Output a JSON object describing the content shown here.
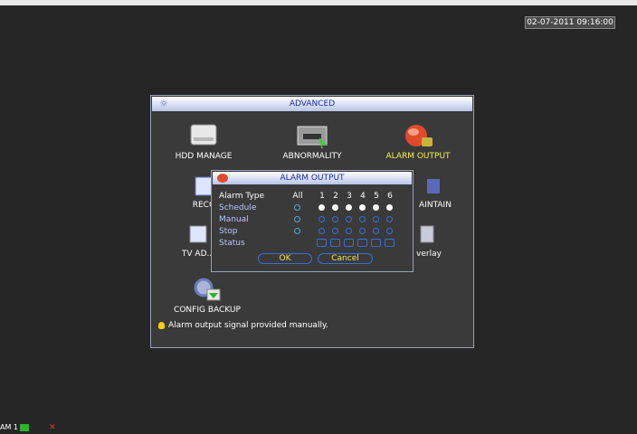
{
  "datetime": "02-07-2011 09:16:00",
  "advanced": {
    "title": "ADVANCED",
    "items": [
      {
        "label": "HDD MANAGE",
        "icon": "hdd-icon"
      },
      {
        "label": "ABNORMALITY",
        "icon": "abnormality-icon"
      },
      {
        "label": "ALARM OUTPUT",
        "icon": "alarm-output-icon",
        "selected": true
      },
      {
        "label": "RECC",
        "icon": "record-icon"
      },
      {
        "label": "AINTAIN",
        "icon": "maintain-icon"
      },
      {
        "label": "TV AD...",
        "icon": "tv-adjust-icon"
      },
      {
        "label": "verlay",
        "icon": "overlay-icon"
      },
      {
        "label": "CONFIG BACKUP",
        "icon": "config-backup-icon"
      }
    ],
    "hint": "Alarm output signal provided manually."
  },
  "dialog": {
    "title": "ALARM OUTPUT",
    "row_labels": {
      "type": "Alarm Type",
      "schedule": "Schedule",
      "manual": "Manual",
      "stop": "Stop",
      "status": "Status"
    },
    "col_all": "All",
    "channels": [
      "1",
      "2",
      "3",
      "4",
      "5",
      "6"
    ],
    "selected_mode": "schedule",
    "ok": "OK",
    "cancel": "Cancel"
  },
  "statusbar": {
    "channel_label": "AM 1"
  },
  "colors": {
    "title_text": "#1d2aa8",
    "highlight": "#f4f04a",
    "button_text": "#f0e85a",
    "radio_border": "#3b6dd6"
  }
}
